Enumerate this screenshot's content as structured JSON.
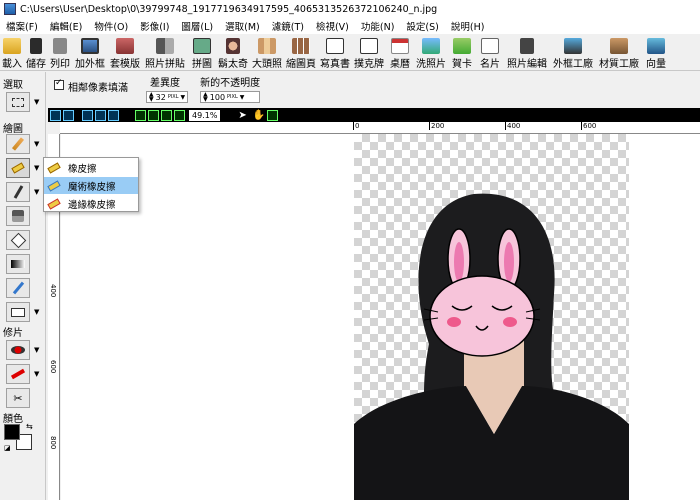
{
  "window": {
    "title": "C:\\Users\\User\\Desktop\\0\\39799748_1917719634917595_4065313526372106240_n.jpg"
  },
  "menu": [
    "檔案(F)",
    "編輯(E)",
    "物件(O)",
    "影像(I)",
    "圖層(L)",
    "選取(M)",
    "濾鏡(T)",
    "檢視(V)",
    "功能(N)",
    "設定(S)",
    "說明(H)"
  ],
  "toolbar": [
    {
      "label": "載入",
      "icon": "open-folder-icon"
    },
    {
      "label": "儲存",
      "icon": "save-disk-icon"
    },
    {
      "label": "列印",
      "icon": "printer-icon"
    },
    {
      "label": "加外框",
      "icon": "frame-icon"
    },
    {
      "label": "套模版",
      "icon": "template-icon"
    },
    {
      "label": "照片拼貼",
      "icon": "collage-icon"
    },
    {
      "label": "拼圖",
      "icon": "puzzle-icon"
    },
    {
      "label": "鬍太奇",
      "icon": "face-icon"
    },
    {
      "label": "大頭照",
      "icon": "id-photo-icon"
    },
    {
      "label": "縮圖頁",
      "icon": "thumbnail-icon"
    },
    {
      "label": "寫真書",
      "icon": "photobook-icon"
    },
    {
      "label": "撲克牌",
      "icon": "poker-card-icon"
    },
    {
      "label": "桌曆",
      "icon": "calendar-icon"
    },
    {
      "label": "洗照片",
      "icon": "print-photo-icon"
    },
    {
      "label": "賀卡",
      "icon": "greeting-card-icon"
    },
    {
      "label": "名片",
      "icon": "business-card-icon"
    },
    {
      "label": "照片編輯",
      "icon": "photo-edit-icon"
    },
    {
      "label": "外框工廠",
      "icon": "frame-factory-icon"
    },
    {
      "label": "材質工廠",
      "icon": "texture-factory-icon"
    },
    {
      "label": "向量",
      "icon": "vector-icon"
    }
  ],
  "options": {
    "adjacent_fill_label": "相鄰像素填滿",
    "adjacent_fill_checked": true,
    "tolerance_label": "差異度",
    "tolerance_value": "32",
    "tolerance_unit": "PIXL",
    "opacity_label": "新的不透明度",
    "opacity_value": "100",
    "opacity_unit": "PIXL"
  },
  "left_panel": {
    "select_label": "選取",
    "draw_label": "繪圖",
    "retouch_label": "修片",
    "color_label": "顏色",
    "foreground_color": "#000000",
    "background_color": "#ffffff"
  },
  "eraser_menu": [
    {
      "label": "橡皮擦",
      "selected": false
    },
    {
      "label": "魔術橡皮擦",
      "selected": true
    },
    {
      "label": "邊緣橡皮擦",
      "selected": false
    }
  ],
  "canvas": {
    "zoom": "49.1%"
  },
  "ruler": {
    "h_marks": [
      "0",
      "200",
      "400",
      "600"
    ],
    "v_marks": [
      "400",
      "600",
      "800"
    ]
  },
  "colors": {
    "accent": "#99ccf5",
    "rabbit_pink": "#f7c4da"
  }
}
